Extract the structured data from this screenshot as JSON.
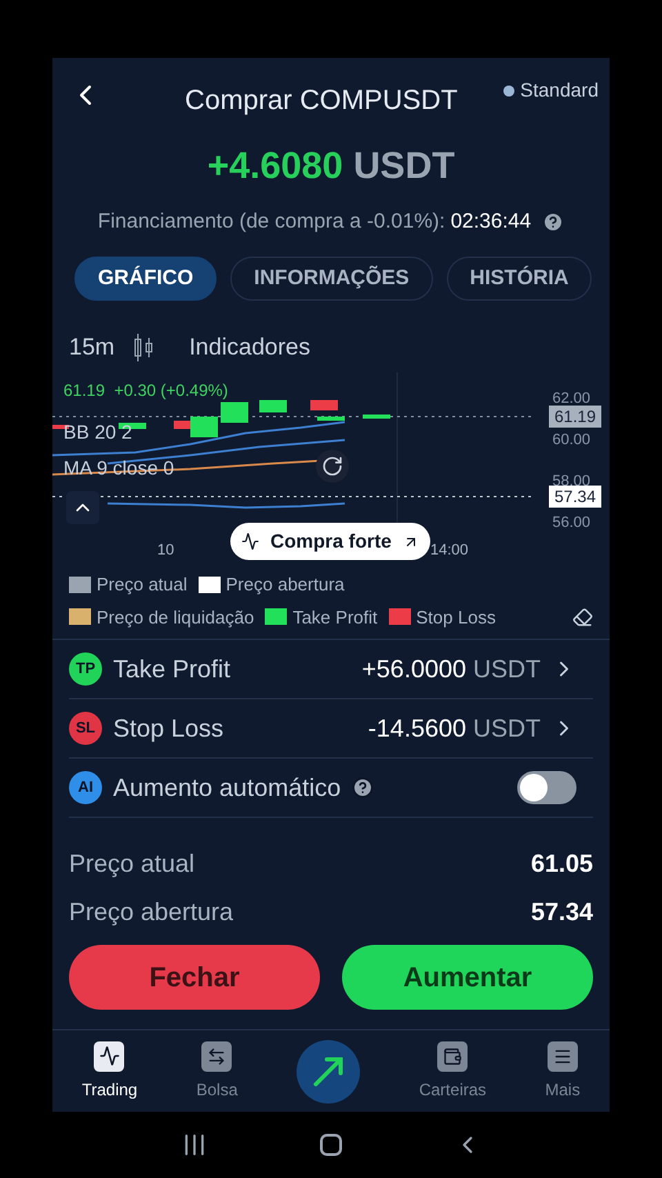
{
  "header": {
    "title": "Comprar COMPUSDT",
    "account": "Standard"
  },
  "pnl": {
    "value": "+4.6080",
    "unit": "USDT"
  },
  "funding": {
    "label": "Financiamento (de compra a -0.01%):",
    "countdown": "02:36:44"
  },
  "tabs": [
    {
      "label": "GRÁFICO",
      "selected": true
    },
    {
      "label": "INFORMAÇÕES",
      "selected": false
    },
    {
      "label": "HISTÓRIA",
      "selected": false
    }
  ],
  "chart_toolbar": {
    "interval": "15m",
    "indicators": "Indicadores"
  },
  "chart": {
    "ohlc": "61.19  +0.30 (+0.49%)",
    "indicators": [
      "BB 20 2",
      "MA 9 close 0"
    ],
    "y_axis_labels": [
      "62.00",
      "60.00",
      "58.00",
      "56.00"
    ],
    "price_tags": [
      {
        "label": "61.19",
        "kind": "current"
      },
      {
        "label": "57.34",
        "kind": "open"
      }
    ],
    "x_axis_labels": [
      "10",
      "14:00"
    ],
    "signal": "Compra forte"
  },
  "legend": [
    {
      "label": "Preço atual",
      "color": "#9aa4b1"
    },
    {
      "label": "Preço abertura",
      "color": "#ffffff"
    },
    {
      "label": "Preço de liquidação",
      "color": "#d9b06c"
    },
    {
      "label": "Take Profit",
      "color": "#22e05a"
    },
    {
      "label": "Stop Loss",
      "color": "#ec3c48"
    }
  ],
  "settings": [
    {
      "kind": "tp",
      "badge": "TP",
      "label": "Take Profit",
      "value": "+56.0000",
      "unit": "USDT"
    },
    {
      "kind": "sl",
      "badge": "SL",
      "label": "Stop Loss",
      "value": "-14.5600",
      "unit": "USDT"
    },
    {
      "kind": "toggle",
      "badge": "AI",
      "label": "Aumento automático",
      "on": false
    }
  ],
  "stats": [
    {
      "label": "Preço atual",
      "value": "61.05"
    },
    {
      "label": "Preço abertura",
      "value": "57.34"
    }
  ],
  "actions": {
    "close": "Fechar",
    "increase": "Aumentar"
  },
  "nav": [
    {
      "label": "Trading",
      "kind": "chart",
      "selected": true
    },
    {
      "label": "Bolsa",
      "kind": "exchange",
      "selected": false
    },
    {
      "kind": "center",
      "selected": false
    },
    {
      "label": "Carteiras",
      "kind": "wallet",
      "selected": false
    },
    {
      "label": "Mais",
      "kind": "more",
      "selected": false
    }
  ]
}
